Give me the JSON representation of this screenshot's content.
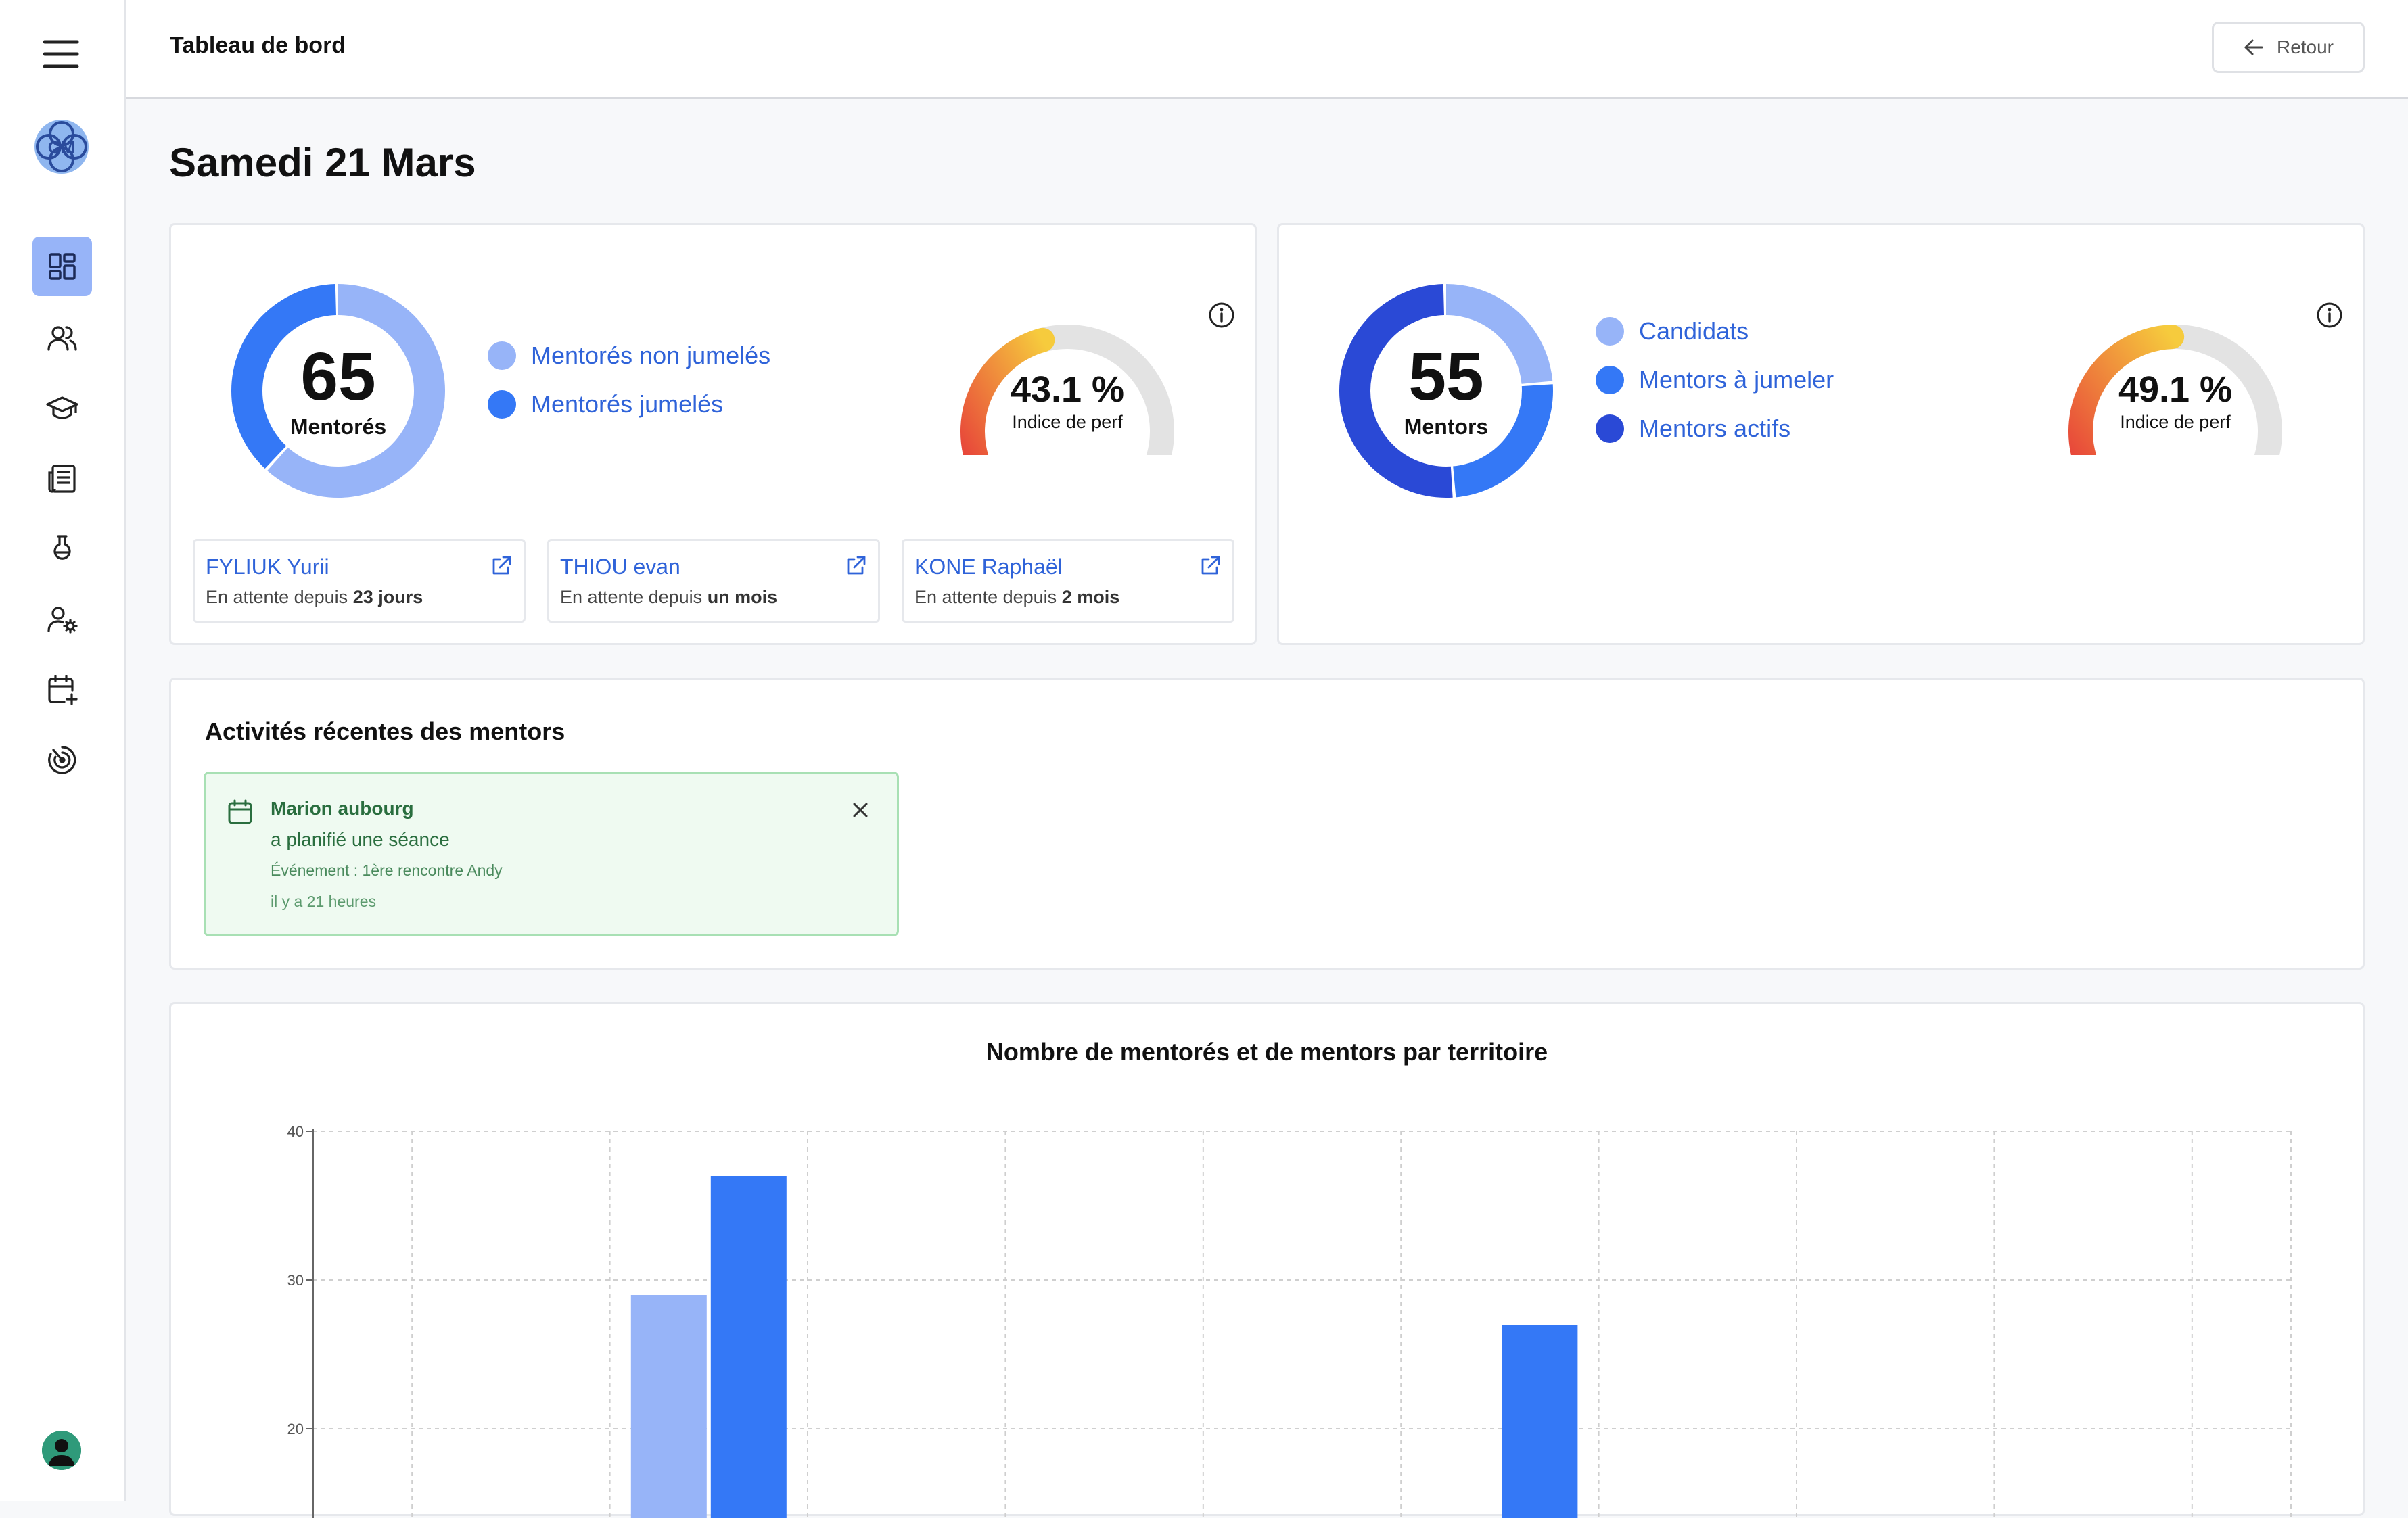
{
  "header": {
    "title": "Tableau de bord",
    "back_label": "Retour"
  },
  "page": {
    "date_title": "Samedi 21 Mars"
  },
  "sidebar": {
    "items": [
      {
        "name": "dashboard",
        "icon": "dashboard-icon",
        "active": true
      },
      {
        "name": "users",
        "icon": "users-icon",
        "active": false
      },
      {
        "name": "graduation",
        "icon": "graduation-cap-icon",
        "active": false
      },
      {
        "name": "news",
        "icon": "newspaper-icon",
        "active": false
      },
      {
        "name": "lab",
        "icon": "flask-icon",
        "active": false
      },
      {
        "name": "user-settings",
        "icon": "user-cog-icon",
        "active": false
      },
      {
        "name": "calendar",
        "icon": "calendar-plus-icon",
        "active": false
      },
      {
        "name": "target",
        "icon": "radar-icon",
        "active": false
      }
    ]
  },
  "mentees_card": {
    "total": "65",
    "total_label": "Mentorés",
    "segments": [
      {
        "label": "Mentorés non jumelés",
        "color": "#97b4f8",
        "value": 0.62
      },
      {
        "label": "Mentorés jumelés",
        "color": "#3478f6",
        "value": 0.38
      }
    ],
    "gauge": {
      "value_text": "43.1 %",
      "label": "Indice de perf",
      "value": 43.1
    },
    "waiting": [
      {
        "name": "FYLIUK Yurii",
        "prefix": "En attente depuis",
        "duration": "23 jours"
      },
      {
        "name": "THIOU evan",
        "prefix": "En attente depuis",
        "duration": "un mois"
      },
      {
        "name": "KONE Raphaël",
        "prefix": "En attente depuis",
        "duration": "2 mois"
      }
    ]
  },
  "mentors_card": {
    "total": "55",
    "total_label": "Mentors",
    "segments": [
      {
        "label": "Candidats",
        "color": "#97b4f8",
        "value": 0.24
      },
      {
        "label": "Mentors à jumeler",
        "color": "#3478f6",
        "value": 0.25
      },
      {
        "label": "Mentors actifs",
        "color": "#2a49d6",
        "value": 0.51
      }
    ],
    "gauge": {
      "value_text": "49.1 %",
      "label": "Indice de perf",
      "value": 49.1
    }
  },
  "activities": {
    "title": "Activités récentes des mentors",
    "items": [
      {
        "name": "Marion aubourg",
        "text": "a planifié une séance",
        "event": "Événement : 1ère rencontre Andy",
        "time": "il y a 21 heures"
      }
    ]
  },
  "chart": {
    "title": "Nombre de mentorés et de mentors par territoire"
  },
  "chart_data": {
    "type": "bar",
    "title": "Nombre de mentorés et de mentors par territoire",
    "xlabel": "",
    "ylabel": "",
    "yticks": [
      "40",
      "30",
      "20"
    ],
    "ylim": [
      17.5,
      40
    ],
    "grid": true,
    "categories": [
      "",
      "",
      "",
      "",
      "",
      "",
      "",
      "",
      "",
      ""
    ],
    "series": [
      {
        "color": "#97b4f8",
        "values": [
          null,
          29,
          null,
          null,
          null,
          null,
          null,
          null,
          null,
          null
        ]
      },
      {
        "color": "#3478f6",
        "values": [
          null,
          37,
          null,
          null,
          null,
          27,
          null,
          null,
          null,
          null
        ]
      }
    ]
  }
}
